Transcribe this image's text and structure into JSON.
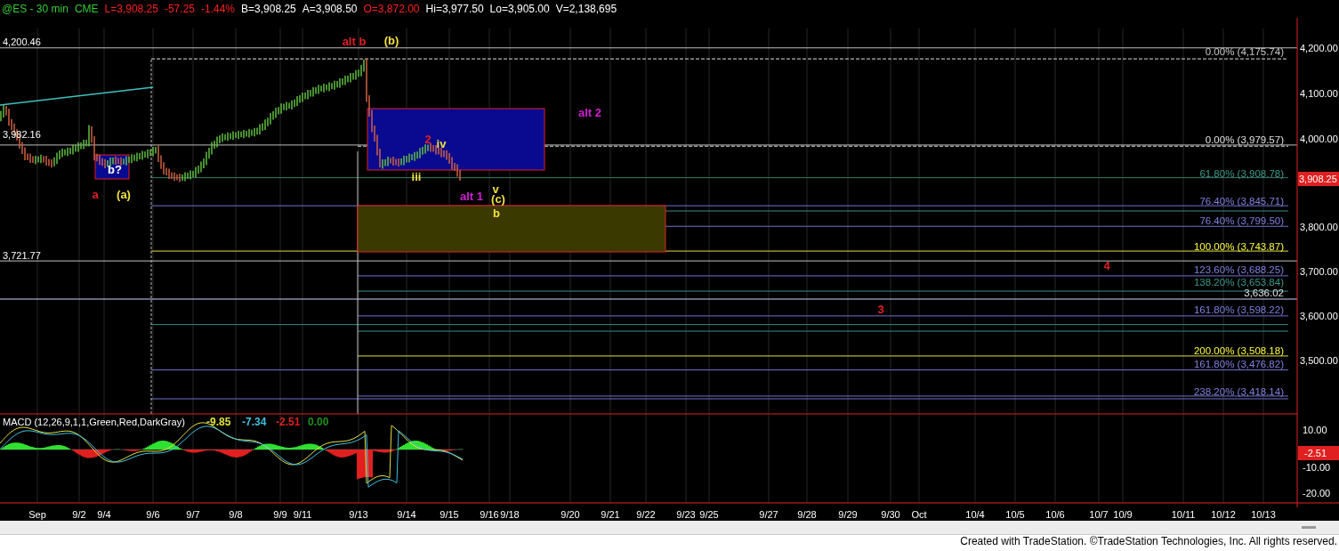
{
  "header": {
    "items": [
      {
        "text": "@ES - 30 min",
        "color": "#33cc33"
      },
      {
        "text": "CME",
        "color": "#33cc33"
      },
      {
        "text": "L=3,908.25",
        "color": "#ff2020"
      },
      {
        "text": "-57.25",
        "color": "#ff2020"
      },
      {
        "text": "-1.44%",
        "color": "#ff2020"
      },
      {
        "text": "B=3,908.25",
        "color": "#ffffff"
      },
      {
        "text": "A=3,908.50",
        "color": "#ffffff"
      },
      {
        "text": "O=3,872.00",
        "color": "#ff2020"
      },
      {
        "text": "Hi=3,977.50",
        "color": "#ffffff"
      },
      {
        "text": "Lo=3,905.00",
        "color": "#ffffff"
      },
      {
        "text": "V=2,138,695",
        "color": "#ffffff"
      }
    ]
  },
  "price_chart": {
    "left_labels": [
      "4,200.46",
      "3,982.16",
      "3,721.77"
    ],
    "axis_labels": [
      "4,200.00",
      "4,100.00",
      "4,000.00",
      "3,800.00",
      "3,700.00",
      "3,600.00",
      "3,500.00"
    ],
    "last_price": "3,908.25",
    "level_labels": [
      {
        "text": "0.00% (4,175.74)",
        "color": "#c8c8c8"
      },
      {
        "text": "0.00% (3,979.57)",
        "color": "#e0e0e0"
      },
      {
        "text": "61.80% (3,908.78)",
        "color": "#3a9a8a"
      },
      {
        "text": "76.40% (3,845.71)",
        "color": "#8080e0"
      },
      {
        "text": "76.40% (3,799.50)",
        "color": "#8080e0"
      },
      {
        "text": "100.00% (3,743.87)",
        "color": "#ffff40"
      },
      {
        "text": "123.60% (3,688.25)",
        "color": "#8080e0"
      },
      {
        "text": "138.20% (3,653.84)",
        "color": "#3a9a8a"
      },
      {
        "text": "3,636.02",
        "color": "#e0e0e0"
      },
      {
        "text": "161.80% (3,598.22)",
        "color": "#8080e0"
      },
      {
        "text": "200.00% (3,508.18)",
        "color": "#ffff40"
      },
      {
        "text": "161.80% (3,476.82)",
        "color": "#8080e0"
      },
      {
        "text": "238.20% (3,418.14)",
        "color": "#8080e0"
      }
    ],
    "wave_labels": [
      {
        "text": "alt b",
        "color": "#e02020"
      },
      {
        "text": "(b)",
        "color": "#f0e040"
      },
      {
        "text": "a",
        "color": "#e02020"
      },
      {
        "text": "(a)",
        "color": "#f0e040"
      },
      {
        "text": "b?",
        "color": "#ffffff"
      },
      {
        "text": "alt 2",
        "color": "#d020d0"
      },
      {
        "text": "2",
        "color": "#e02020"
      },
      {
        "text": "iv",
        "color": "#f0e040"
      },
      {
        "text": "iii",
        "color": "#f0e040"
      },
      {
        "text": "alt 1",
        "color": "#d020d0"
      },
      {
        "text": "v",
        "color": "#f0e040"
      },
      {
        "text": "(c)",
        "color": "#f0e040"
      },
      {
        "text": "b",
        "color": "#f0e040"
      },
      {
        "text": "4",
        "color": "#e02020"
      },
      {
        "text": "3",
        "color": "#e02020"
      }
    ]
  },
  "macd": {
    "title": "MACD (12,26,9,1,1,Green,Red,DarkGray)",
    "readings": [
      {
        "text": "-9.85",
        "color": "#e0e040"
      },
      {
        "text": "-7.34",
        "color": "#40c0e0"
      },
      {
        "text": "-2.51",
        "color": "#e02020"
      },
      {
        "text": "0.00",
        "color": "#209020"
      }
    ],
    "axis_labels": [
      "10.00",
      "-10.00",
      "-20.00"
    ],
    "last_value": "-2.51"
  },
  "time_axis": [
    "Sep",
    "9/2",
    "9/4",
    "9/6",
    "9/7",
    "9/8",
    "9/9",
    "9/11",
    "9/13",
    "9/14",
    "9/15",
    "9/16",
    "9/18",
    "9/20",
    "9/21",
    "9/22",
    "9/23",
    "9/25",
    "9/27",
    "9/28",
    "9/29",
    "9/30",
    "Oct",
    "10/4",
    "10/5",
    "10/6",
    "10/7",
    "10/9",
    "10/11",
    "10/12",
    "10/13"
  ],
  "footer": "Created with TradeStation. ©TradeStation Technologies, Inc. All rights reserved."
}
